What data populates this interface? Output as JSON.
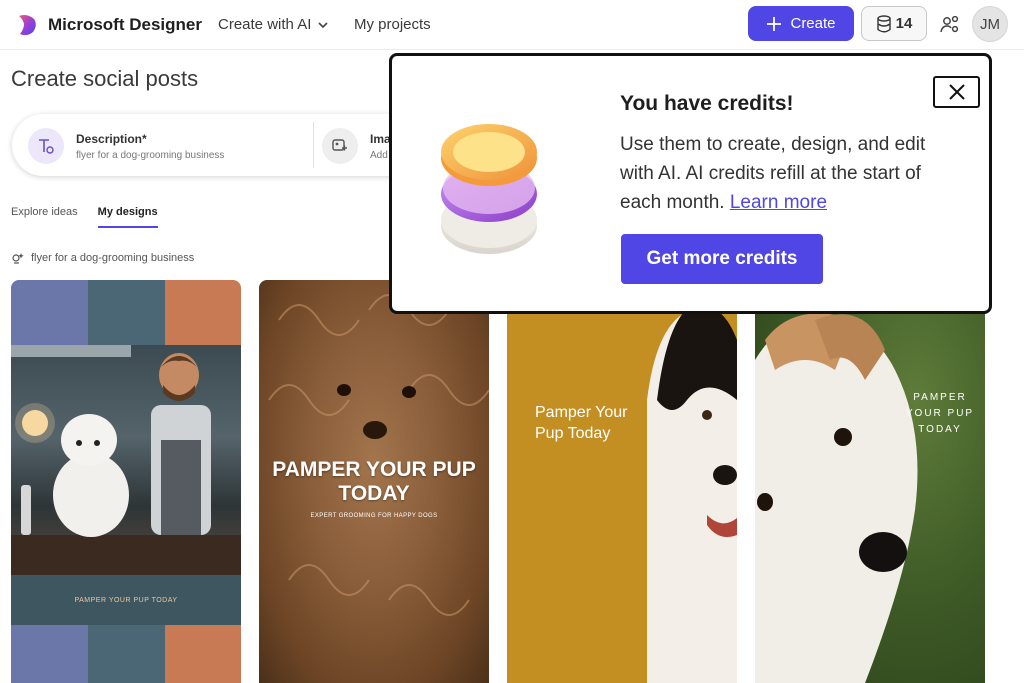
{
  "header": {
    "brand": "Microsoft Designer",
    "nav": [
      {
        "label": "Create with AI"
      },
      {
        "label": "My projects"
      }
    ],
    "create_label": "Create",
    "credits_count": "14",
    "avatar_initials": "JM"
  },
  "page": {
    "title": "Create social posts",
    "description_field": {
      "title": "Description*",
      "value": "flyer for a dog-grooming business"
    },
    "image_field": {
      "title": "Ima",
      "value": "Add"
    },
    "tabs": [
      {
        "label": "Explore ideas",
        "active": false
      },
      {
        "label": "My designs",
        "active": true
      }
    ],
    "query": "flyer for a dog-grooming business"
  },
  "designs": [
    {
      "caption": "PAMPER YOUR PUP TODAY",
      "palette": [
        "#6a77a8",
        "#4b6675",
        "#c87a55"
      ]
    },
    {
      "headline": "PAMPER YOUR PUP TODAY",
      "subline": "EXPERT GROOMING FOR HAPPY DOGS"
    },
    {
      "headline_line1": "Pamper Your",
      "headline_line2": "Pup Today"
    },
    {
      "headline_line1": "PAMPER",
      "headline_line2": "YOUR PUP",
      "headline_line3": "TODAY"
    }
  ],
  "popup": {
    "title": "You have credits!",
    "body": "Use them to create, design, and edit with AI. AI credits refill at the start of each month. ",
    "link": "Learn more",
    "cta": "Get more credits"
  },
  "colors": {
    "accent": "#4f46e5",
    "popup_border": "#111111"
  }
}
